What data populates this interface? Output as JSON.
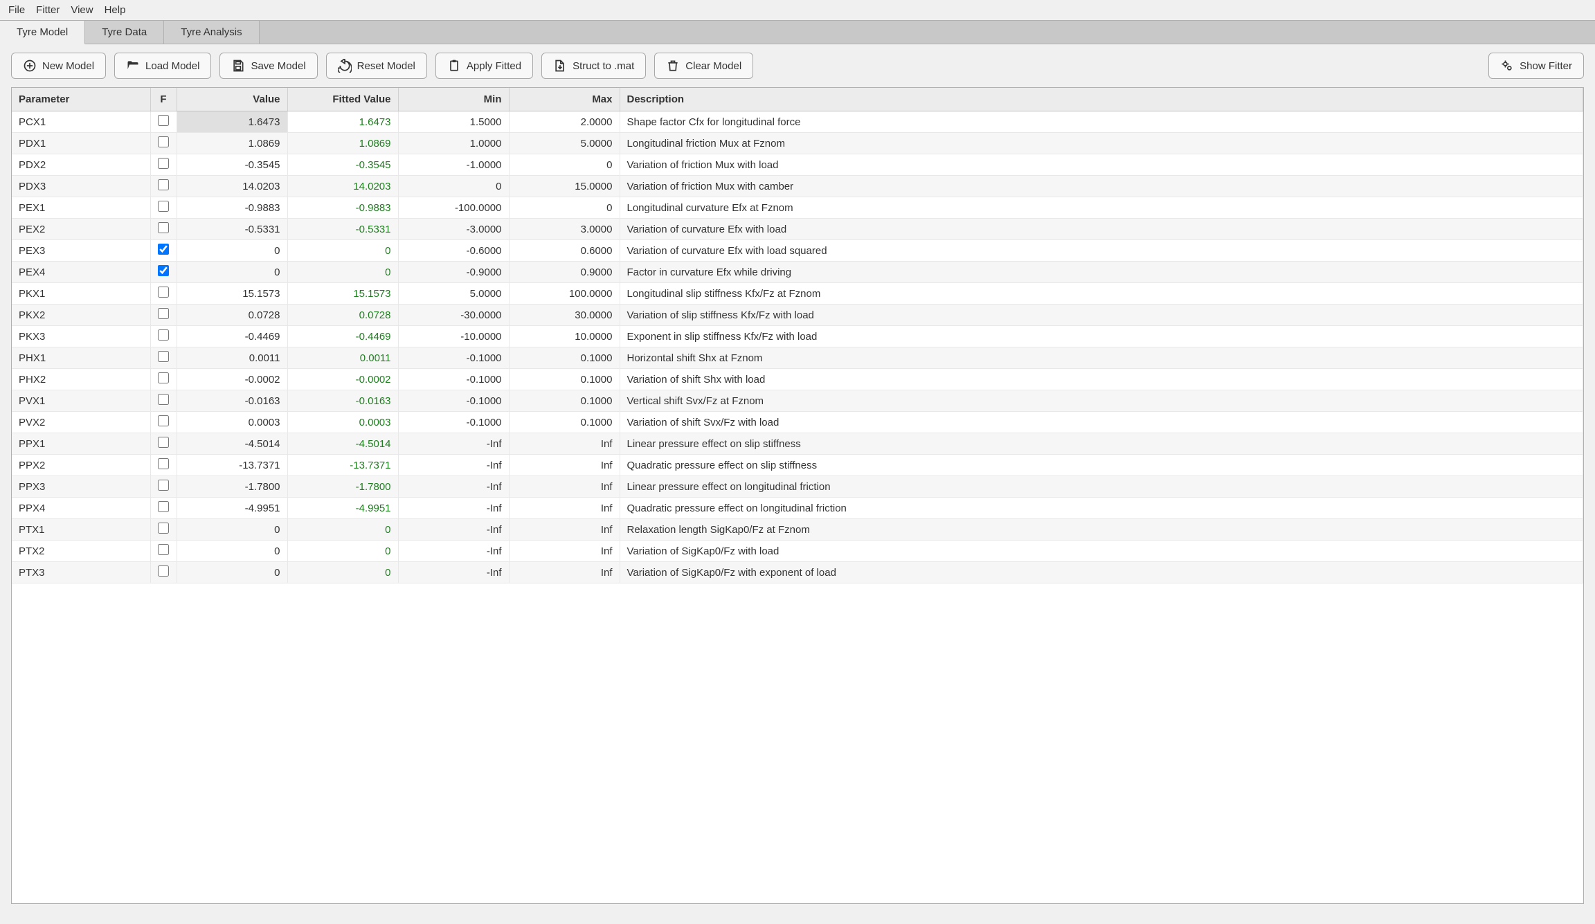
{
  "menu": {
    "items": [
      "File",
      "Fitter",
      "View",
      "Help"
    ]
  },
  "tabs": {
    "items": [
      "Tyre Model",
      "Tyre Data",
      "Tyre Analysis"
    ],
    "active": 0
  },
  "toolbar": {
    "new_model": "New Model",
    "load_model": "Load Model",
    "save_model": "Save Model",
    "reset_model": "Reset Model",
    "apply_fitted": "Apply Fitted",
    "struct_to_mat": "Struct to .mat",
    "clear_model": "Clear Model",
    "show_fitter": "Show Fitter"
  },
  "columns": {
    "parameter": "Parameter",
    "f": "F",
    "value": "Value",
    "fitted": "Fitted Value",
    "min": "Min",
    "max": "Max",
    "description": "Description"
  },
  "rows": [
    {
      "param": "PCX1",
      "f": false,
      "value": "1.6473",
      "fitted": "1.6473",
      "min": "1.5000",
      "max": "2.0000",
      "desc": "Shape factor Cfx for longitudinal force",
      "selected": true
    },
    {
      "param": "PDX1",
      "f": false,
      "value": "1.0869",
      "fitted": "1.0869",
      "min": "1.0000",
      "max": "5.0000",
      "desc": "Longitudinal friction Mux at Fznom"
    },
    {
      "param": "PDX2",
      "f": false,
      "value": "-0.3545",
      "fitted": "-0.3545",
      "min": "-1.0000",
      "max": "0",
      "desc": "Variation of friction Mux with load"
    },
    {
      "param": "PDX3",
      "f": false,
      "value": "14.0203",
      "fitted": "14.0203",
      "min": "0",
      "max": "15.0000",
      "desc": "Variation of friction Mux with camber"
    },
    {
      "param": "PEX1",
      "f": false,
      "value": "-0.9883",
      "fitted": "-0.9883",
      "min": "-100.0000",
      "max": "0",
      "desc": "Longitudinal curvature Efx at Fznom"
    },
    {
      "param": "PEX2",
      "f": false,
      "value": "-0.5331",
      "fitted": "-0.5331",
      "min": "-3.0000",
      "max": "3.0000",
      "desc": "Variation of curvature Efx with load"
    },
    {
      "param": "PEX3",
      "f": true,
      "value": "0",
      "fitted": "0",
      "min": "-0.6000",
      "max": "0.6000",
      "desc": "Variation of curvature Efx with load squared"
    },
    {
      "param": "PEX4",
      "f": true,
      "value": "0",
      "fitted": "0",
      "min": "-0.9000",
      "max": "0.9000",
      "desc": "Factor in curvature Efx while driving"
    },
    {
      "param": "PKX1",
      "f": false,
      "value": "15.1573",
      "fitted": "15.1573",
      "min": "5.0000",
      "max": "100.0000",
      "desc": "Longitudinal slip stiffness Kfx/Fz at Fznom"
    },
    {
      "param": "PKX2",
      "f": false,
      "value": "0.0728",
      "fitted": "0.0728",
      "min": "-30.0000",
      "max": "30.0000",
      "desc": "Variation of slip stiffness Kfx/Fz with load"
    },
    {
      "param": "PKX3",
      "f": false,
      "value": "-0.4469",
      "fitted": "-0.4469",
      "min": "-10.0000",
      "max": "10.0000",
      "desc": "Exponent in slip stiffness Kfx/Fz with load"
    },
    {
      "param": "PHX1",
      "f": false,
      "value": "0.0011",
      "fitted": "0.0011",
      "min": "-0.1000",
      "max": "0.1000",
      "desc": "Horizontal shift Shx at Fznom"
    },
    {
      "param": "PHX2",
      "f": false,
      "value": "-0.0002",
      "fitted": "-0.0002",
      "min": "-0.1000",
      "max": "0.1000",
      "desc": "Variation of shift Shx with load"
    },
    {
      "param": "PVX1",
      "f": false,
      "value": "-0.0163",
      "fitted": "-0.0163",
      "min": "-0.1000",
      "max": "0.1000",
      "desc": "Vertical shift Svx/Fz at Fznom"
    },
    {
      "param": "PVX2",
      "f": false,
      "value": "0.0003",
      "fitted": "0.0003",
      "min": "-0.1000",
      "max": "0.1000",
      "desc": "Variation of shift Svx/Fz with load"
    },
    {
      "param": "PPX1",
      "f": false,
      "value": "-4.5014",
      "fitted": "-4.5014",
      "min": "-Inf",
      "max": "Inf",
      "desc": "Linear pressure effect on slip stiffness"
    },
    {
      "param": "PPX2",
      "f": false,
      "value": "-13.7371",
      "fitted": "-13.7371",
      "min": "-Inf",
      "max": "Inf",
      "desc": "Quadratic pressure effect on slip stiffness"
    },
    {
      "param": "PPX3",
      "f": false,
      "value": "-1.7800",
      "fitted": "-1.7800",
      "min": "-Inf",
      "max": "Inf",
      "desc": "Linear pressure effect on longitudinal friction"
    },
    {
      "param": "PPX4",
      "f": false,
      "value": "-4.9951",
      "fitted": "-4.9951",
      "min": "-Inf",
      "max": "Inf",
      "desc": "Quadratic pressure effect on longitudinal friction"
    },
    {
      "param": "PTX1",
      "f": false,
      "value": "0",
      "fitted": "0",
      "min": "-Inf",
      "max": "Inf",
      "desc": "Relaxation length SigKap0/Fz at Fznom"
    },
    {
      "param": "PTX2",
      "f": false,
      "value": "0",
      "fitted": "0",
      "min": "-Inf",
      "max": "Inf",
      "desc": "Variation of SigKap0/Fz with load"
    },
    {
      "param": "PTX3",
      "f": false,
      "value": "0",
      "fitted": "0",
      "min": "-Inf",
      "max": "Inf",
      "desc": "Variation of SigKap0/Fz with exponent of load"
    }
  ]
}
